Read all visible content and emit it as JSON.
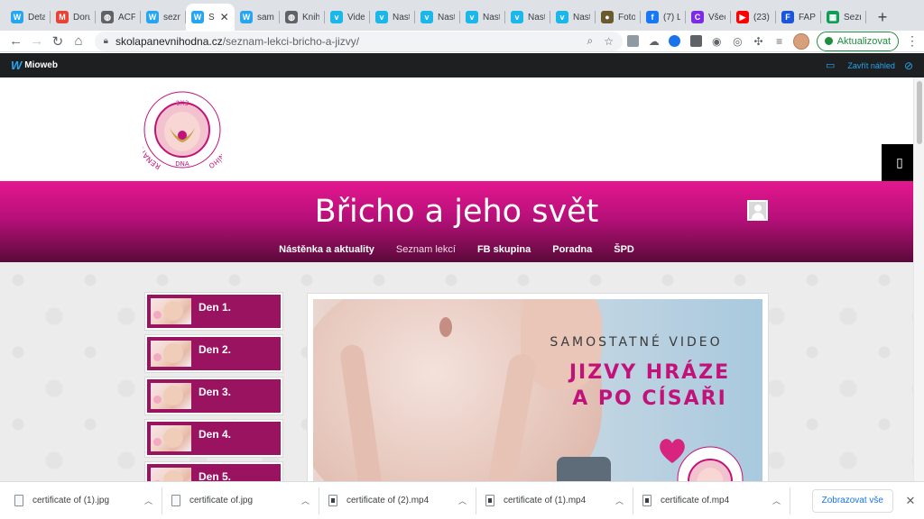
{
  "browser": {
    "tabs": [
      {
        "title": "Deta",
        "icon": "mioweb-icon",
        "color": "#26a6f0",
        "glyph": "W"
      },
      {
        "title": "Doru",
        "icon": "gmail-icon",
        "color": "#ea4335",
        "glyph": "M"
      },
      {
        "title": "ACF:",
        "icon": "globe-icon",
        "color": "#5f6368",
        "glyph": "◍"
      },
      {
        "title": "sezn",
        "icon": "mioweb-icon",
        "color": "#26a6f0",
        "glyph": "W"
      },
      {
        "title": "S",
        "icon": "mioweb-icon",
        "color": "#26a6f0",
        "glyph": "W",
        "active": true
      },
      {
        "title": "samo",
        "icon": "mioweb-icon",
        "color": "#26a6f0",
        "glyph": "W"
      },
      {
        "title": "Knih",
        "icon": "globe-icon",
        "color": "#5f6368",
        "glyph": "◍"
      },
      {
        "title": "Vide",
        "icon": "vimeo-icon",
        "color": "#1ab7ea",
        "glyph": "v"
      },
      {
        "title": "Nast",
        "icon": "vimeo-icon",
        "color": "#1ab7ea",
        "glyph": "v"
      },
      {
        "title": "Nast",
        "icon": "vimeo-icon",
        "color": "#1ab7ea",
        "glyph": "v"
      },
      {
        "title": "Nast",
        "icon": "vimeo-icon",
        "color": "#1ab7ea",
        "glyph": "v"
      },
      {
        "title": "Nast",
        "icon": "vimeo-icon",
        "color": "#1ab7ea",
        "glyph": "v"
      },
      {
        "title": "Nast",
        "icon": "vimeo-icon",
        "color": "#1ab7ea",
        "glyph": "v"
      },
      {
        "title": "Foto",
        "icon": "photo-icon",
        "color": "#6b5a2c",
        "glyph": "●"
      },
      {
        "title": "(7) L",
        "icon": "facebook-icon",
        "color": "#1877f2",
        "glyph": "f"
      },
      {
        "title": "Všec",
        "icon": "canva-icon",
        "color": "#7d2ae8",
        "glyph": "C"
      },
      {
        "title": "(23)",
        "icon": "youtube-icon",
        "color": "#ff0000",
        "glyph": "▶"
      },
      {
        "title": "FAPI",
        "icon": "fapi-icon",
        "color": "#1a56db",
        "glyph": "F"
      },
      {
        "title": "Sezn",
        "icon": "sheets-icon",
        "color": "#0f9d58",
        "glyph": "▦"
      }
    ],
    "new_tab": "+",
    "url_host": "skolapanevnihodna.cz",
    "url_path": "/seznam-lekci-bricho-a-jizvy/",
    "update_label": "Aktualizovat"
  },
  "adminbar": {
    "brand": "Mioweb",
    "close_preview": "Zavřít náhled"
  },
  "site": {
    "logo_text": {
      "top": "3X3",
      "left": "RENATY SAHANÍ",
      "right": "ŠKOLA PÁNEVNÍHO",
      "bottom": "DNA"
    },
    "title": "Břicho a jeho svět",
    "nav": [
      {
        "label": "Nástěnka a aktuality",
        "current": false
      },
      {
        "label": "Seznam lekcí",
        "current": true
      },
      {
        "label": "FB skupina",
        "current": false
      },
      {
        "label": "Poradna",
        "current": false
      },
      {
        "label": "ŠPD",
        "current": false
      }
    ],
    "lessons": [
      "Den 1.",
      "Den 2.",
      "Den 3.",
      "Den 4.",
      "Den 5."
    ],
    "feature": {
      "overline": "SAMOSTATNÉ VIDEO",
      "headline_line1": "JIZVY HRÁZE",
      "headline_line2": "A PO CÍSAŘI"
    }
  },
  "downloads": {
    "items": [
      {
        "name": "certificate of (1).jpg",
        "type": "image"
      },
      {
        "name": "certificate of.jpg",
        "type": "image"
      },
      {
        "name": "certificate of (2).mp4",
        "type": "video"
      },
      {
        "name": "certificate of (1).mp4",
        "type": "video"
      },
      {
        "name": "certificate of.mp4",
        "type": "video"
      }
    ],
    "show_all": "Zobrazovat vše"
  },
  "colors": {
    "brand_magenta": "#c2127a",
    "lesson_bg": "#9a1361",
    "mioweb_blue": "#26a6f0"
  }
}
